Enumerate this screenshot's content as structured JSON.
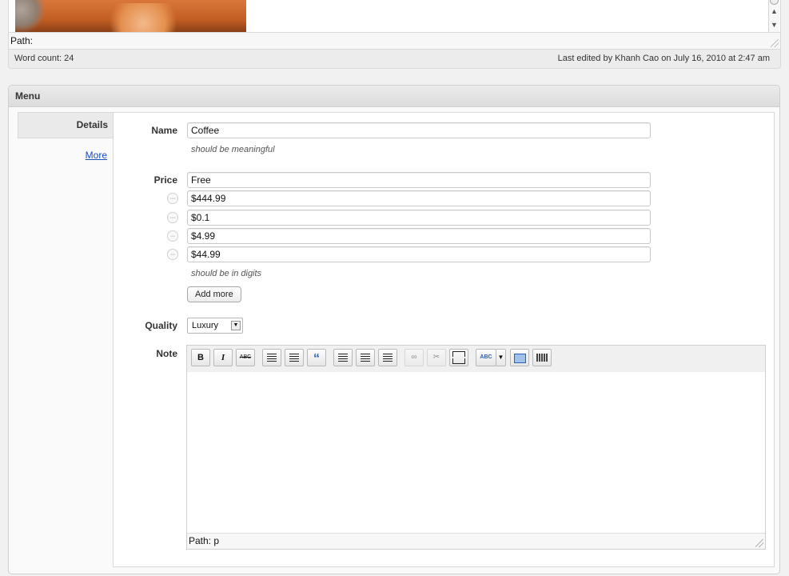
{
  "top_editor": {
    "path_label": "Path:",
    "word_count": "Word count: 24",
    "last_edited": "Last edited by Khanh Cao on July 16, 2010 at 2:47 am",
    "scroll_up": "▲",
    "scroll_down": "▼"
  },
  "menu": {
    "title": "Menu",
    "tabs": [
      {
        "label": "Details"
      },
      {
        "label": "More"
      }
    ],
    "fields": {
      "name": {
        "label": "Name",
        "value": "Coffee",
        "hint": "should be meaningful"
      },
      "price": {
        "label": "Price",
        "values": [
          "Free",
          "$444.99",
          "$0.1",
          "$4.99",
          "$44.99"
        ],
        "hint": "should be in digits",
        "add_more_label": "Add more"
      },
      "quality": {
        "label": "Quality",
        "selected": "Luxury"
      },
      "note": {
        "label": "Note",
        "path_label": "Path: p"
      }
    },
    "toolbar": {
      "bold": "B",
      "italic": "I",
      "strike": "ABC",
      "blockquote": "“",
      "spellcheck": "ABC"
    }
  },
  "colors": {
    "link": "#1b4fb9",
    "panel_header": "#dcdcdc"
  }
}
